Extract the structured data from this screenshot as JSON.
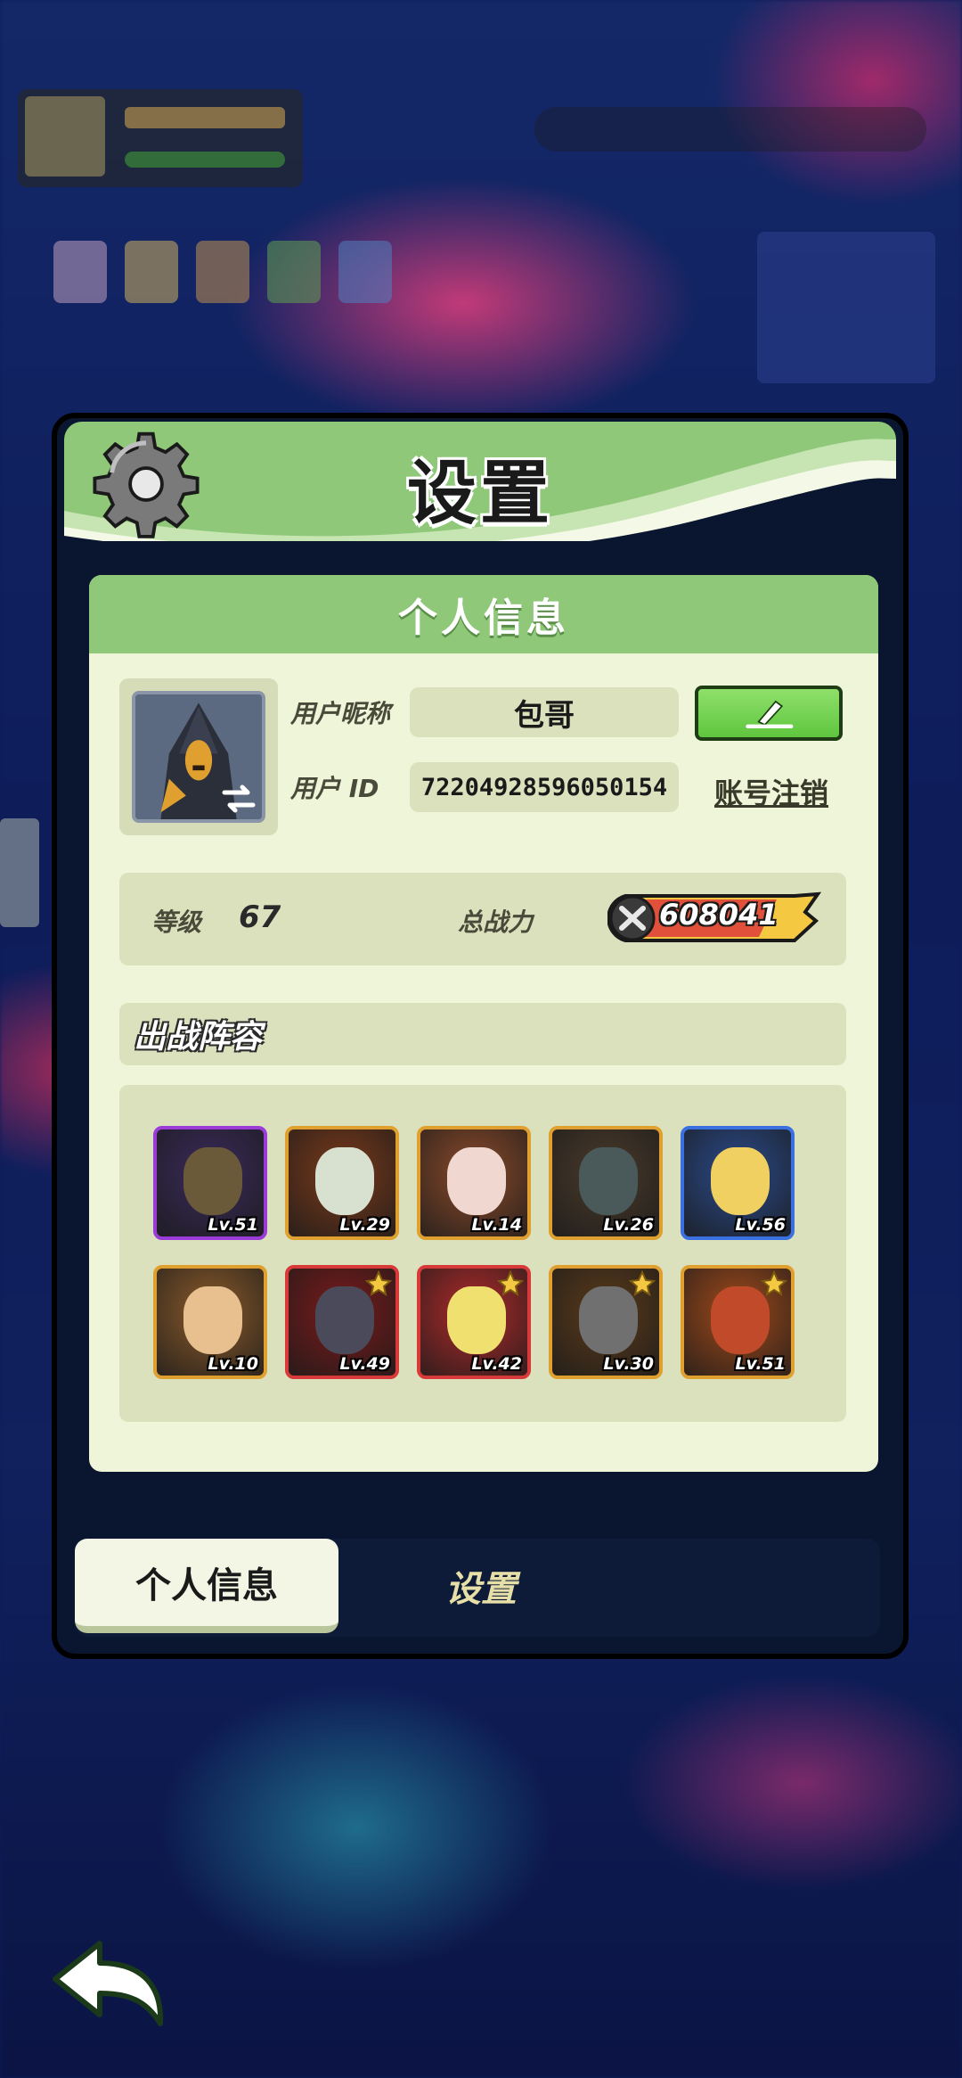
{
  "dialog": {
    "title": "设置",
    "section_title": "个人信息"
  },
  "profile": {
    "nickname_label": "用户昵称",
    "nickname": "包哥",
    "id_label": "用户 ID",
    "user_id": "72204928596050154",
    "delete_account_label": "账号注销"
  },
  "stats": {
    "level_label": "等级",
    "level": "67",
    "power_label": "总战力",
    "power": "608041"
  },
  "lineup": {
    "title": "出战阵容",
    "heroes": [
      {
        "level": "Lv.51",
        "frame": "#9b3cd8",
        "bg": "#3a2a5a",
        "face": "#6a5a3a",
        "star": false
      },
      {
        "level": "Lv.29",
        "frame": "#e0a030",
        "bg": "#7a3a1a",
        "face": "#d8e0d0",
        "star": false
      },
      {
        "level": "Lv.14",
        "frame": "#e0a030",
        "bg": "#8a4a2a",
        "face": "#f0d8d0",
        "star": false
      },
      {
        "level": "Lv.26",
        "frame": "#e0a030",
        "bg": "#4a3a2a",
        "face": "#4a5a5a",
        "star": false
      },
      {
        "level": "Lv.56",
        "frame": "#3a70e0",
        "bg": "#2a4a8a",
        "face": "#f0d060",
        "star": false
      },
      {
        "level": "Lv.10",
        "frame": "#e0a030",
        "bg": "#8a5a2a",
        "face": "#e8c090",
        "star": false
      },
      {
        "level": "Lv.49",
        "frame": "#d83a3a",
        "bg": "#7a1a1a",
        "face": "#4a4a5a",
        "star": true
      },
      {
        "level": "Lv.42",
        "frame": "#d83a3a",
        "bg": "#b02a2a",
        "face": "#f0e070",
        "star": true
      },
      {
        "level": "Lv.30",
        "frame": "#e0a030",
        "bg": "#5a3a1a",
        "face": "#707070",
        "star": true
      },
      {
        "level": "Lv.51",
        "frame": "#e0a030",
        "bg": "#a04a1a",
        "face": "#c04a2a",
        "star": true
      }
    ]
  },
  "tabs": {
    "active": "个人信息",
    "inactive": "设置"
  },
  "icons": {
    "gear": "gear-icon",
    "edit": "pencil-icon",
    "swap": "swap-arrows-icon",
    "power": "crossed-swords-icon",
    "back": "back-arrow-icon"
  },
  "colors": {
    "header_green": "#8ec878",
    "card_bg": "#eef5d8",
    "field_bg": "#dbe0bd",
    "edit_button": "#5fc63f",
    "power_badge": "#f5c842"
  }
}
